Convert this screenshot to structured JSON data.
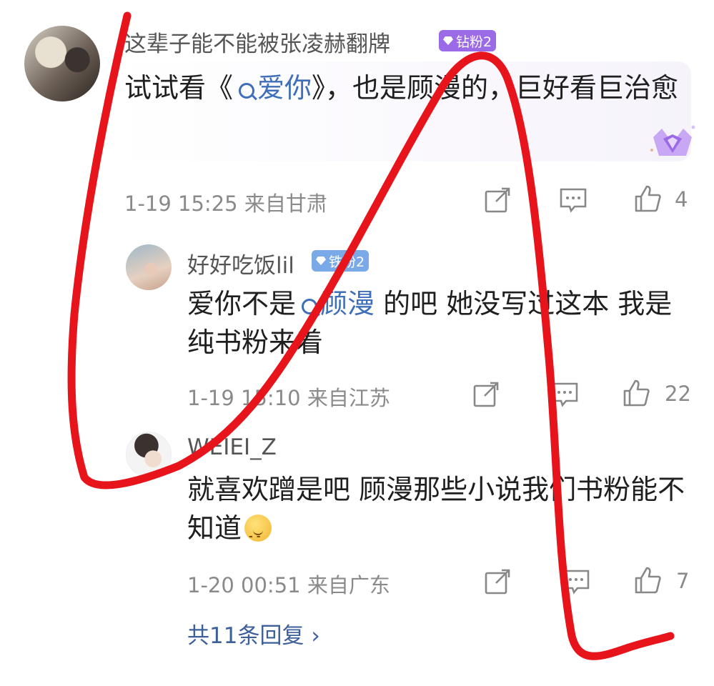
{
  "main_comment": {
    "username": "这辈子能不能被张凌赫翻牌",
    "badge": "钻粉2",
    "text_before": "试试看《",
    "link": "爱你",
    "text_after": "》，也是顾漫的，巨好看巨治愈",
    "time": "1-19 15:25",
    "location": "来自甘肃",
    "likes": "4"
  },
  "replies": [
    {
      "username": "好好吃饭lil",
      "badge": "铁粉2",
      "text_before": "爱你不是",
      "link": "顾漫",
      "text_after": " 的吧 她没写过这本 我是纯书粉来着",
      "time": "1-19 15:10",
      "location": "来自江苏",
      "likes": "22"
    },
    {
      "username": "WEIEI_Z",
      "text": "就喜欢蹭是吧 顾漫那些小说我们书粉能不知道",
      "emoji_icon": "sleepy-face-emoji",
      "time": "1-20 00:51",
      "location": "来自广东",
      "likes": "7"
    }
  ],
  "more_replies": "共11条回复",
  "colors": {
    "link": "#3e6fb8",
    "diamond_badge": "#9b6ae6",
    "iron_badge": "#7aa9e8",
    "scribble": "#e8141c"
  }
}
